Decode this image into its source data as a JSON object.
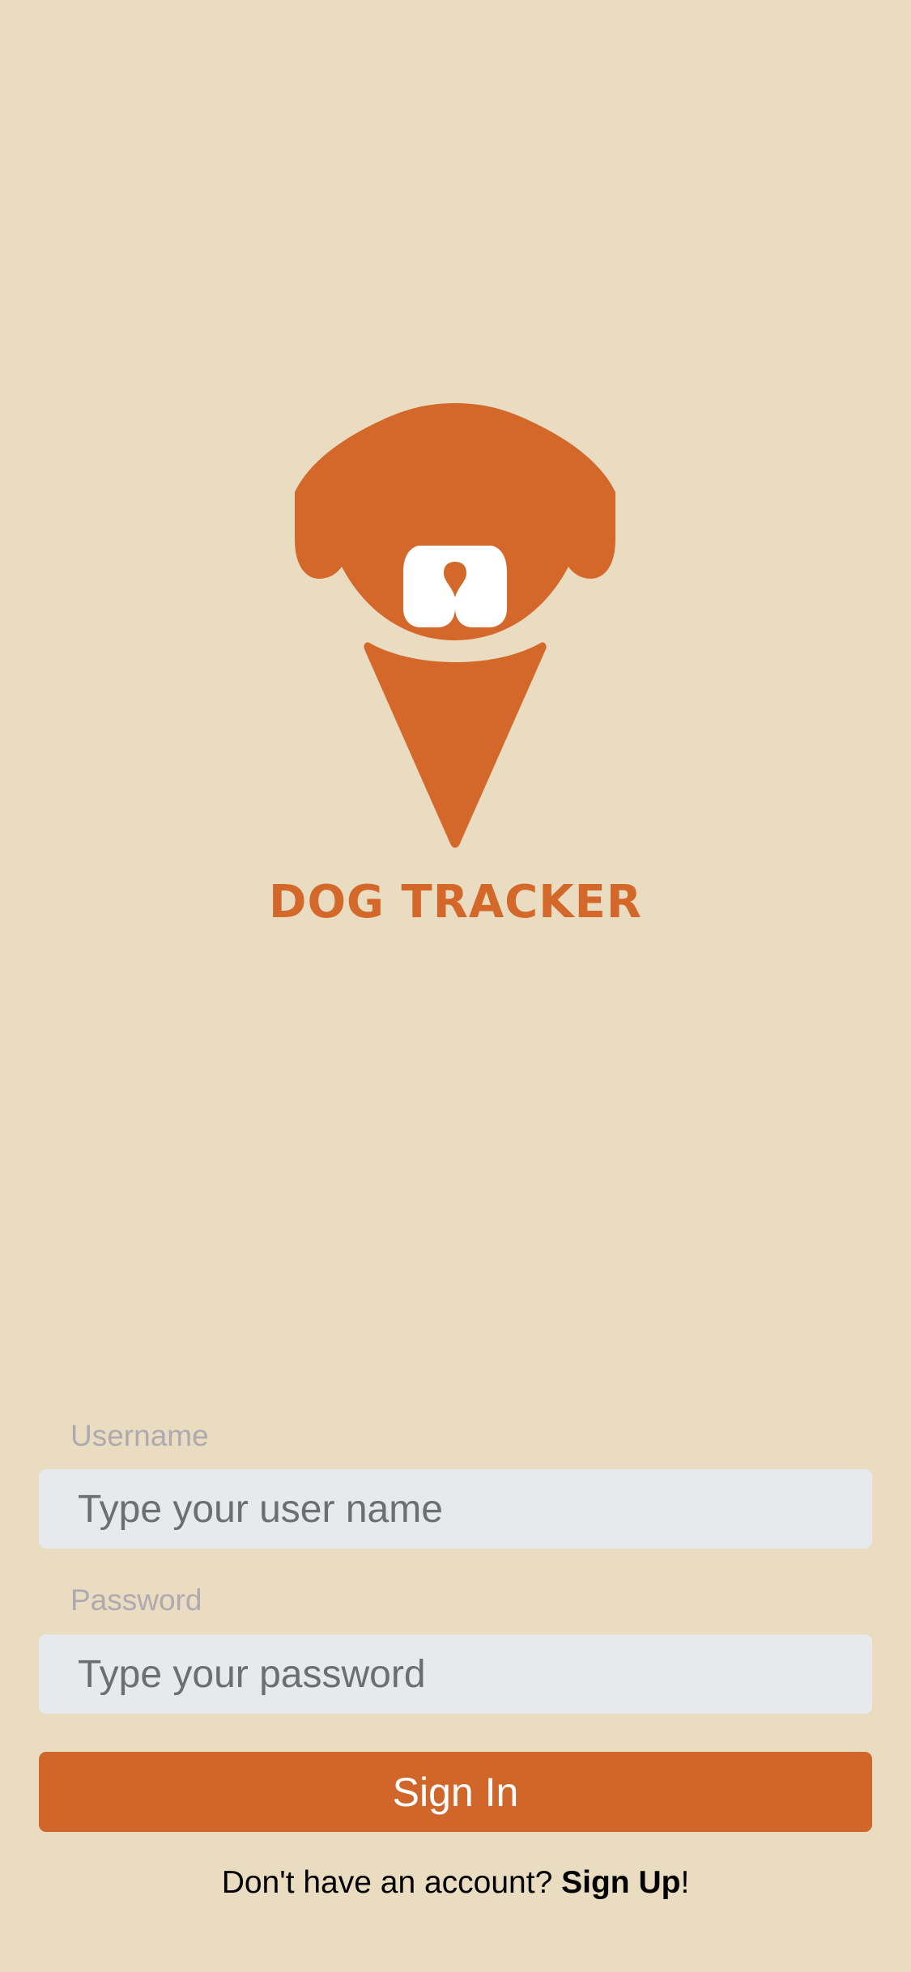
{
  "brand": {
    "logo_icon": "dog-ice-cream-cone-logo",
    "name": "DOG TRACKER",
    "color": "#D4682A"
  },
  "login_form": {
    "username": {
      "label": "Username",
      "placeholder": "Type your user name",
      "value": ""
    },
    "password": {
      "label": "Password",
      "placeholder": "Type your password",
      "value": ""
    },
    "sign_in_label": "Sign In"
  },
  "signup_prompt": {
    "text": "Don't have an account? ",
    "link_label": "Sign Up",
    "suffix": "!"
  },
  "colors": {
    "background": "#E9DCC1",
    "accent": "#D0662A",
    "input_background": "#E7E9EC",
    "label_gray": "#AEAAB0"
  }
}
